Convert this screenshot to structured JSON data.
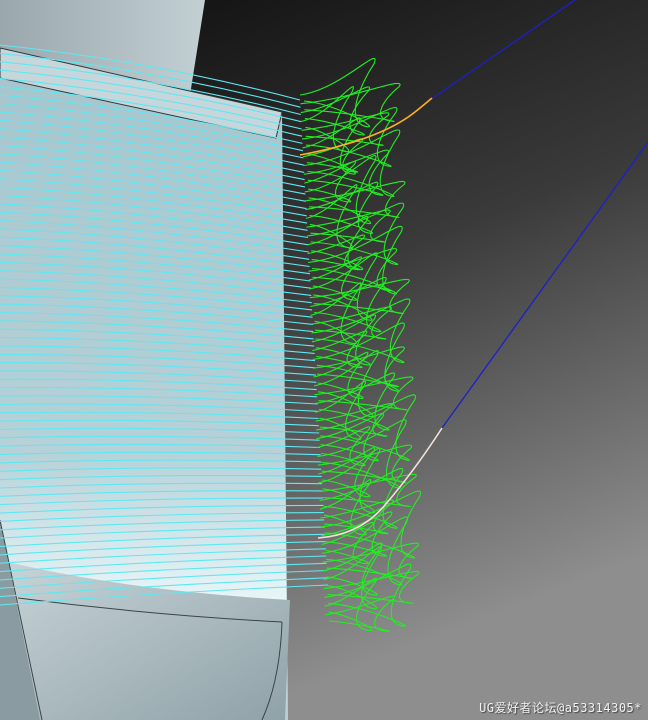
{
  "viewport": {
    "watermark": "UG爱好者论坛@a53314305*",
    "colors": {
      "toolpath_cut": "#5fe8f0",
      "toolpath_loop": "#22ee22",
      "engage_move": "#ffb020",
      "retract_move": "#f3e3d8",
      "rapid_move": "#1a22c8",
      "part_surface": "#b9d0d8",
      "background_dark": "#111111",
      "background_light": "#8a8a8a"
    }
  }
}
